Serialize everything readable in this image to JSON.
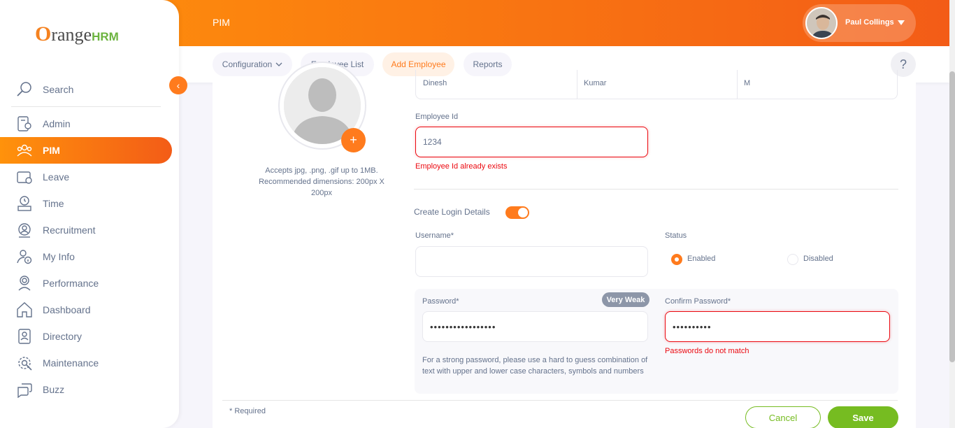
{
  "header": {
    "module": "PIM",
    "user_name": "Paul Collings"
  },
  "logo": {
    "o": "O",
    "text": "range",
    "hrm": "HRM"
  },
  "subnav": {
    "tabs": [
      {
        "label": "Configuration"
      },
      {
        "label": "Employee List"
      },
      {
        "label": "Add Employee"
      },
      {
        "label": "Reports"
      }
    ],
    "help": "?"
  },
  "sidebar": {
    "search_label": "Search",
    "collapse_icon": "‹",
    "items": [
      {
        "label": "Admin",
        "icon": "admin-icon"
      },
      {
        "label": "PIM",
        "icon": "pim-icon",
        "active": true
      },
      {
        "label": "Leave",
        "icon": "leave-icon"
      },
      {
        "label": "Time",
        "icon": "time-icon"
      },
      {
        "label": "Recruitment",
        "icon": "recruitment-icon"
      },
      {
        "label": "My Info",
        "icon": "my-info-icon"
      },
      {
        "label": "Performance",
        "icon": "performance-icon"
      },
      {
        "label": "Dashboard",
        "icon": "dashboard-icon"
      },
      {
        "label": "Directory",
        "icon": "directory-icon"
      },
      {
        "label": "Maintenance",
        "icon": "maintenance-icon"
      },
      {
        "label": "Buzz",
        "icon": "buzz-icon"
      }
    ]
  },
  "form": {
    "photo_hint": "Accepts jpg, .png, .gif up to 1MB. Recommended dimensions: 200px X 200px",
    "photo_add": "+",
    "first_name": "Dinesh",
    "middle_name": "Kumar",
    "last_name": "M",
    "employee_id_label": "Employee Id",
    "employee_id_value": "1234",
    "employee_id_error": "Employee Id already exists",
    "create_login_label": "Create Login Details",
    "create_login_enabled": true,
    "username_label": "Username*",
    "username_value": "",
    "status_label": "Status",
    "status_options": [
      {
        "label": "Enabled",
        "selected": true
      },
      {
        "label": "Disabled",
        "selected": false
      }
    ],
    "password_label": "Password*",
    "password_value": "•••••••••••••••••",
    "password_strength": "Very Weak",
    "password_hint": "For a strong password, please use a hard to guess combination of text with upper and lower case characters, symbols and numbers",
    "confirm_label": "Confirm Password*",
    "confirm_value": "••••••••••",
    "confirm_error": "Passwords do not match",
    "required_note": "* Required",
    "cancel_label": "Cancel",
    "save_label": "Save"
  },
  "colors": {
    "accent": "#ff7b1d",
    "success": "#76bc21",
    "error": "#eb0910"
  }
}
